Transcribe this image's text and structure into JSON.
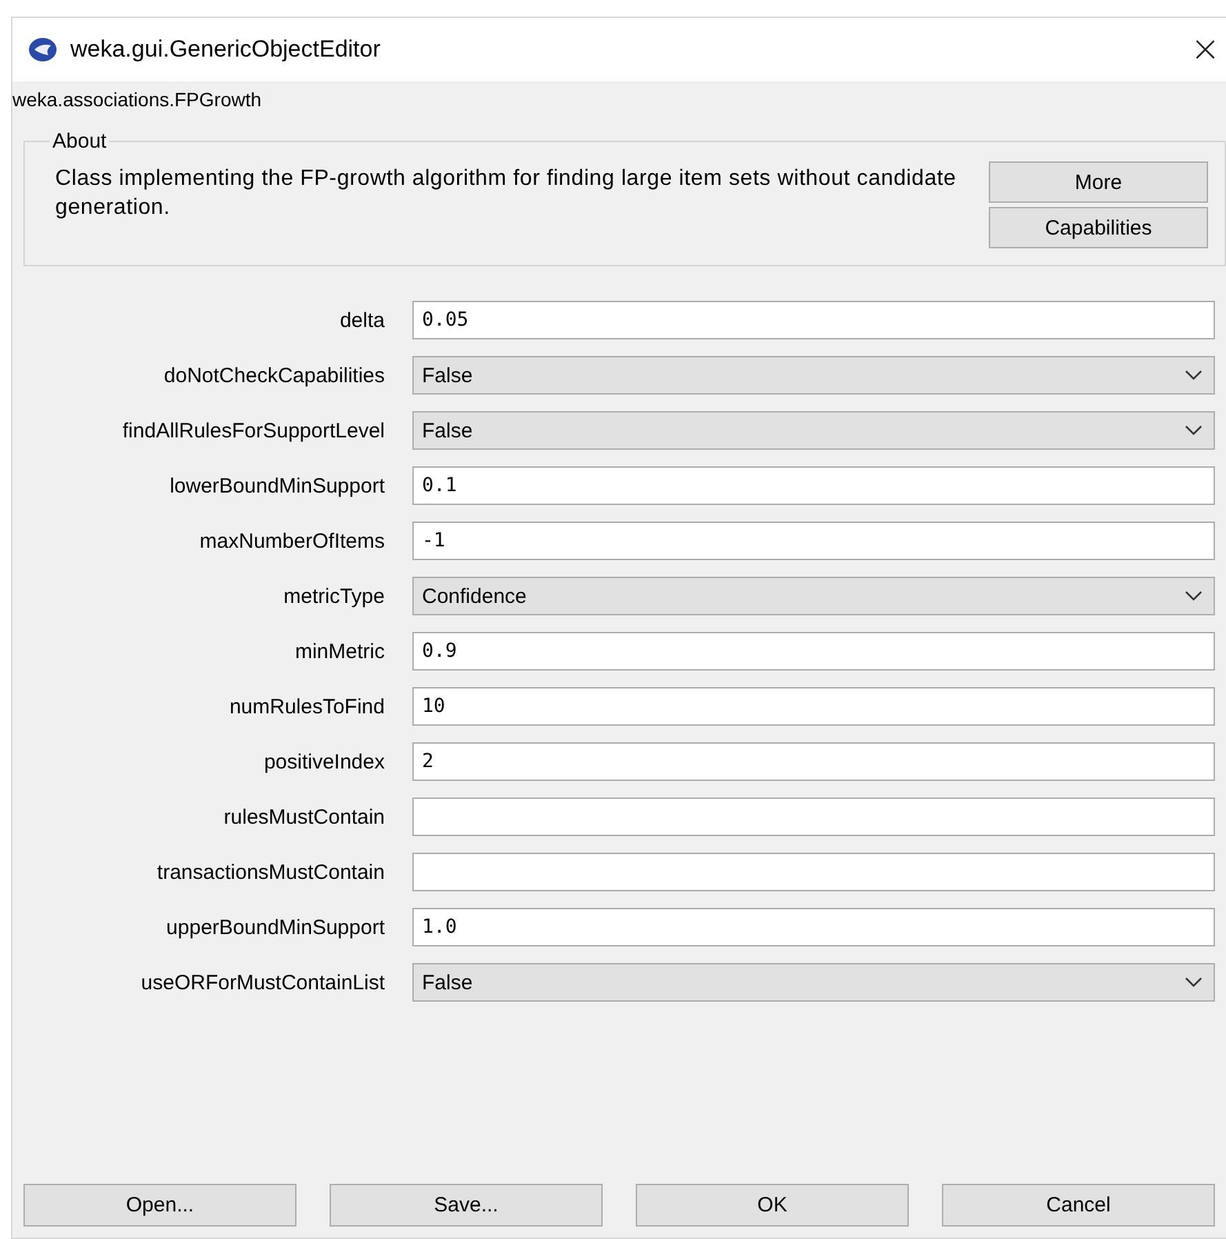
{
  "window": {
    "title": "weka.gui.GenericObjectEditor",
    "close": "×"
  },
  "class_name": "weka.associations.FPGrowth",
  "about": {
    "title": "About",
    "text": "Class implementing the FP-growth algorithm for finding large item sets without candidate generation.",
    "buttons": [
      "More",
      "Capabilities"
    ]
  },
  "properties": [
    {
      "label": "delta",
      "kind": "text",
      "value": "0.05"
    },
    {
      "label": "doNotCheckCapabilities",
      "kind": "choice",
      "value": "False"
    },
    {
      "label": "findAllRulesForSupportLevel",
      "kind": "choice",
      "value": "False"
    },
    {
      "label": "lowerBoundMinSupport",
      "kind": "text",
      "value": "0.1"
    },
    {
      "label": "maxNumberOfItems",
      "kind": "text",
      "value": "-1"
    },
    {
      "label": "metricType",
      "kind": "choice",
      "value": "Confidence"
    },
    {
      "label": "minMetric",
      "kind": "text",
      "value": "0.9"
    },
    {
      "label": "numRulesToFind",
      "kind": "text",
      "value": "10"
    },
    {
      "label": "positiveIndex",
      "kind": "text",
      "value": "2"
    },
    {
      "label": "rulesMustContain",
      "kind": "text"
    },
    {
      "label": "transactionsMustContain",
      "kind": "text"
    },
    {
      "label": "upperBoundMinSupport",
      "kind": "text",
      "value": "1.0"
    },
    {
      "label": "useORForMustContainList",
      "kind": "choice",
      "value": "False"
    }
  ],
  "buttons": [
    "Open...",
    "Save...",
    "OK",
    "Cancel"
  ]
}
